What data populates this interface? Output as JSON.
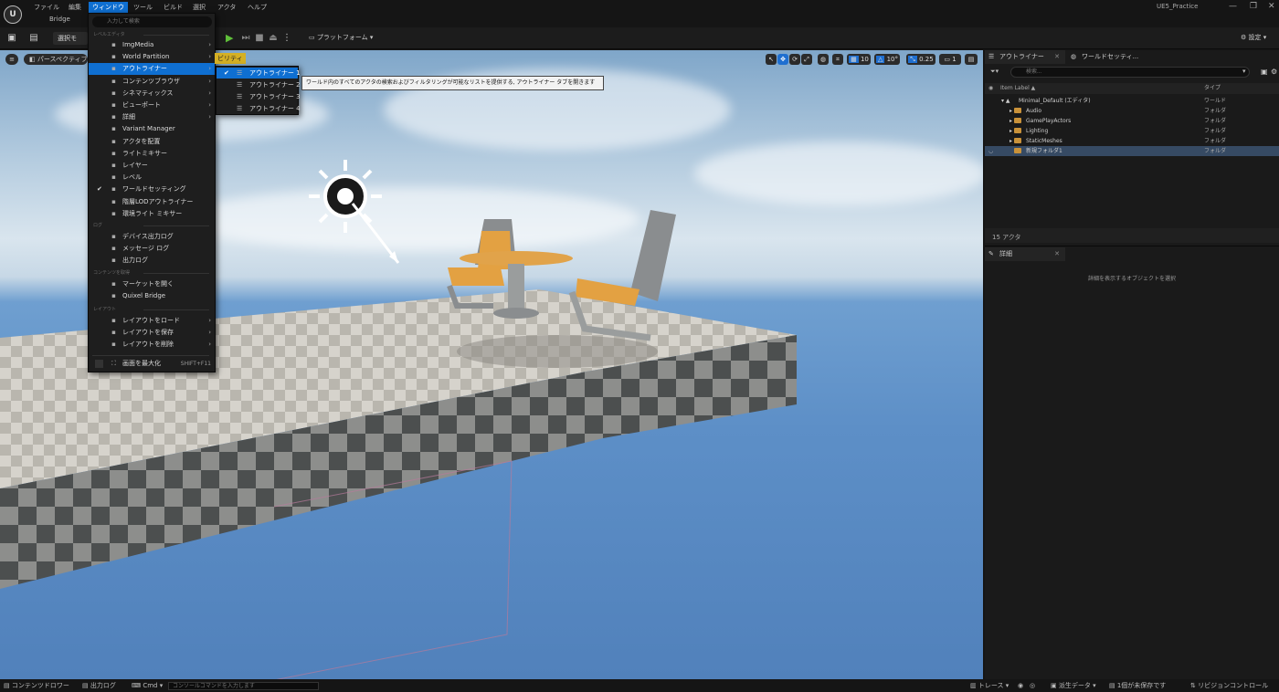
{
  "menubar": {
    "items": [
      "ファイル",
      "編集",
      "ウィンドウ",
      "ツール",
      "ビルド",
      "選択",
      "アクタ",
      "ヘルプ"
    ],
    "active_index": 2,
    "sub_tab": "Bridge",
    "project": "UE5_Practice"
  },
  "toolbar": {
    "select_mode": "選択モ",
    "platform": "プラットフォーム",
    "settings": "設定"
  },
  "viewport": {
    "perspective": "パースペクティブ",
    "utility": "ビリティ",
    "grid_snap": "10",
    "rot_snap": "10°",
    "scale_snap": "0.25",
    "cam_speed": "1"
  },
  "window_menu": {
    "search_placeholder": "入力して検索",
    "section_level_editor": "レベルエディタ",
    "items_level": [
      {
        "label": "ImgMedia",
        "icon": "film-icon",
        "arrow": true
      },
      {
        "label": "World Partition",
        "icon": "grid-icon",
        "arrow": true
      },
      {
        "label": "アウトライナー",
        "icon": "outliner-icon",
        "arrow": true,
        "highlight": true
      },
      {
        "label": "コンテンツブラウザ",
        "icon": "folder-icon",
        "arrow": true
      },
      {
        "label": "シネマティックス",
        "icon": "clapper-icon",
        "arrow": true
      },
      {
        "label": "ビューポート",
        "icon": "viewport-icon",
        "arrow": true
      },
      {
        "label": "詳細",
        "icon": "pencil-icon",
        "arrow": true
      },
      {
        "label": "Variant Manager",
        "icon": "variant-icon"
      },
      {
        "label": "アクタを配置",
        "icon": "place-icon"
      },
      {
        "label": "ライトミキサー",
        "icon": "light-icon"
      },
      {
        "label": "レイヤー",
        "icon": "layers-icon"
      },
      {
        "label": "レベル",
        "icon": "level-icon"
      },
      {
        "label": "ワールドセッティング",
        "icon": "globe-icon",
        "checked": true
      },
      {
        "label": "階層LODアウトライナー",
        "icon": "lod-icon"
      },
      {
        "label": "環境ライト ミキサー",
        "icon": "env-light-icon"
      }
    ],
    "section_log": "ログ",
    "items_log": [
      {
        "label": "デバイス出力ログ",
        "icon": "log-icon"
      },
      {
        "label": "メッセージ ログ",
        "icon": "message-icon"
      },
      {
        "label": "出力ログ",
        "icon": "output-icon"
      }
    ],
    "section_content": "コンテンツを取得",
    "items_content": [
      {
        "label": "マーケットを開く",
        "icon": "market-icon"
      },
      {
        "label": "Quixel Bridge",
        "icon": "bridge-icon"
      }
    ],
    "section_layout": "レイアウト",
    "items_layout": [
      {
        "label": "レイアウトをロード",
        "icon": "load-icon",
        "arrow": true
      },
      {
        "label": "レイアウトを保存",
        "icon": "save-icon",
        "arrow": true
      },
      {
        "label": "レイアウトを削除",
        "icon": "delete-icon",
        "arrow": true
      }
    ],
    "fullscreen_label": "画面を最大化",
    "fullscreen_shortcut": "SHIFT+F11"
  },
  "outliner_submenu": {
    "items": [
      "アウトライナー 1",
      "アウトライナー 2",
      "アウトライナー 3",
      "アウトライナー 4"
    ],
    "tooltip": "ワールド内のすべてのアクタの検索およびフィルタリングが可能なリストを提供する, アウトライナー タブを開きます"
  },
  "outliner": {
    "tab1": "アウトライナー",
    "tab2": "ワールドセッティ...",
    "search_placeholder": "検索...",
    "col_label": "Item Label ▲",
    "col_type": "タイプ",
    "rows": [
      {
        "name": "Minimal_Default (エディタ)",
        "type": "ワールド"
      },
      {
        "name": "Audio",
        "type": "フォルダ"
      },
      {
        "name": "GamePlayActors",
        "type": "フォルダ"
      },
      {
        "name": "Lighting",
        "type": "フォルダ"
      },
      {
        "name": "StaticMeshes",
        "type": "フォルダ"
      },
      {
        "name": "新規フォルダ1",
        "type": "フォルダ"
      }
    ],
    "actor_count": "15 アクタ"
  },
  "details": {
    "tab": "詳細",
    "hint": "詳細を表示するオブジェクトを選択"
  },
  "statusbar": {
    "content_drawer": "コンテンツドロワー",
    "output_log": "出力ログ",
    "cmd": "Cmd",
    "cmd_placeholder": "コンソールコマンドを入力します",
    "trace": "トレース",
    "derived_data": "派生データ",
    "unsaved": "1個が未保存です",
    "revision": "リビジョンコントロール"
  },
  "colors": {
    "accent": "#0f6fd1",
    "play": "#5fbf3a",
    "folder": "#c9923a",
    "selected_row": "#364a63"
  }
}
